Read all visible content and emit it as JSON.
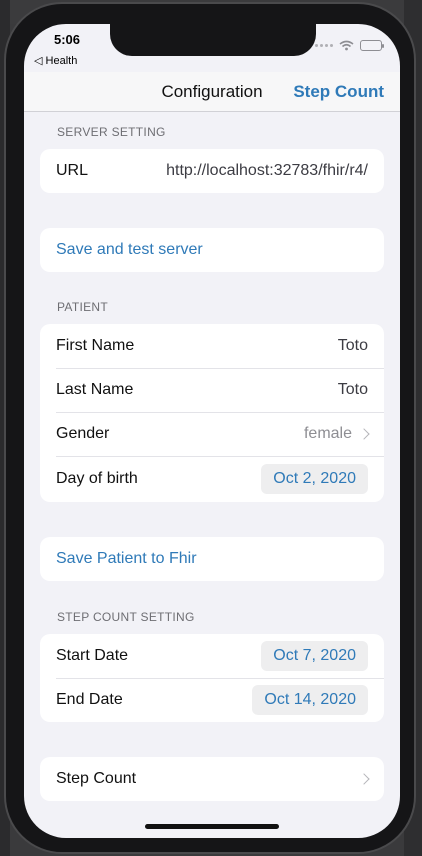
{
  "status": {
    "time": "5:06",
    "back_app": "◁ Health"
  },
  "nav": {
    "title": "Configuration",
    "right_button": "Step Count"
  },
  "server_setting": {
    "header": "SERVER SETTING",
    "url_label": "URL",
    "url_value": "http://localhost:32783/fhir/r4/",
    "save_test_label": "Save and test server"
  },
  "patient": {
    "header": "PATIENT",
    "first_name_label": "First Name",
    "first_name_value": "Toto",
    "last_name_label": "Last Name",
    "last_name_value": "Toto",
    "gender_label": "Gender",
    "gender_value": "female",
    "dob_label": "Day of birth",
    "dob_value": "Oct 2, 2020",
    "save_label": "Save Patient to Fhir"
  },
  "step_count_setting": {
    "header": "STEP COUNT SETTING",
    "start_label": "Start Date",
    "start_value": "Oct 7, 2020",
    "end_label": "End Date",
    "end_value": "Oct 14, 2020"
  },
  "step_count_row": {
    "label": "Step Count"
  },
  "icons": [
    "wifi-icon",
    "battery-icon",
    "chevron-right-icon"
  ],
  "colors": {
    "accent": "#2f7ab8",
    "background": "#f2f2f7"
  }
}
